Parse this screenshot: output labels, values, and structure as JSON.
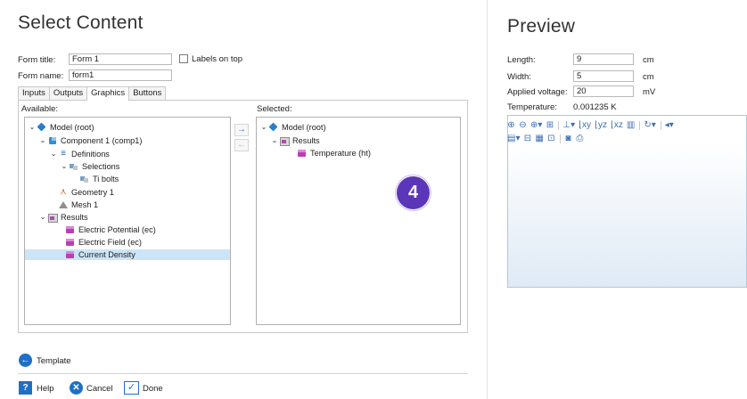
{
  "left": {
    "title": "Select Content",
    "form_title_label": "Form title:",
    "form_title_value": "Form 1",
    "labels_on_top": "Labels on top",
    "form_name_label": "Form name:",
    "form_name_value": "form1",
    "tabs": [
      "Inputs",
      "Outputs",
      "Graphics",
      "Buttons"
    ],
    "active_tab": "Graphics",
    "available_label": "Available:",
    "selected_label": "Selected:",
    "available_tree": [
      {
        "label": "Model (root)",
        "icon": "model-icon",
        "chevron": "⌄"
      },
      {
        "label": "Component 1 (comp1)",
        "icon": "component-icon",
        "chevron": "⌄"
      },
      {
        "label": "Definitions",
        "icon": "definitions-icon",
        "chevron": "⌄"
      },
      {
        "label": "Selections",
        "icon": "selections-icon",
        "chevron": "⌄"
      },
      {
        "label": "Ti bolts",
        "icon": "selection-icon",
        "chevron": ""
      },
      {
        "label": "Geometry 1",
        "icon": "geometry-icon",
        "chevron": ""
      },
      {
        "label": "Mesh 1",
        "icon": "mesh-icon",
        "chevron": ""
      },
      {
        "label": "Results",
        "icon": "results-icon",
        "chevron": "⌄"
      },
      {
        "label": "Electric Potential (ec)",
        "icon": "plot-group-icon",
        "chevron": ""
      },
      {
        "label": "Electric Field (ec)",
        "icon": "plot-group-icon",
        "chevron": ""
      },
      {
        "label": "Current Density",
        "icon": "plot-group-icon",
        "chevron": ""
      }
    ],
    "selected_tree": [
      {
        "label": "Model (root)",
        "icon": "model-icon",
        "chevron": "⌄"
      },
      {
        "label": "Results",
        "icon": "results-icon",
        "chevron": "⌄"
      },
      {
        "label": "Temperature (ht)",
        "icon": "plot-group-icon",
        "chevron": ""
      }
    ],
    "badge": "4",
    "template_label": "Template",
    "help_label": "Help",
    "cancel_label": "Cancel",
    "done_label": "Done"
  },
  "preview": {
    "title": "Preview",
    "length_label": "Length:",
    "length_value": "9",
    "length_unit": "cm",
    "width_label": "Width:",
    "width_value": "5",
    "width_unit": "cm",
    "voltage_label": "Applied voltage:",
    "voltage_value": "20",
    "voltage_unit": "mV",
    "temperature_label": "Temperature:",
    "temperature_value": "0.001235 K"
  },
  "colors": {
    "accent": "#1f6fc7",
    "badge": "#5b36b8",
    "selection_highlight": "#cce4f7"
  }
}
